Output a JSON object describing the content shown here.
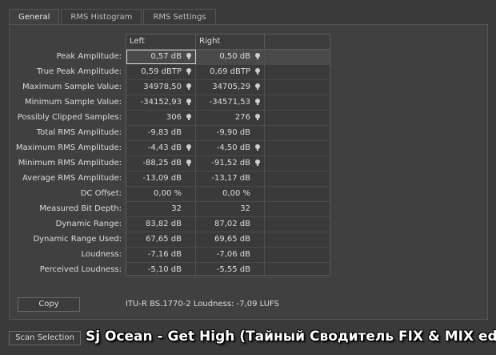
{
  "tabs": [
    "General",
    "RMS Histogram",
    "RMS Settings"
  ],
  "columns": {
    "left": "Left",
    "right": "Right"
  },
  "rows": [
    {
      "label": "Peak Amplitude:",
      "left": "0,57 dB",
      "right": "0,50 dB",
      "left_marker": true,
      "right_marker": true
    },
    {
      "label": "True Peak Amplitude:",
      "left": "0,59 dBTP",
      "right": "0,69 dBTP",
      "left_marker": true,
      "right_marker": true
    },
    {
      "label": "Maximum Sample Value:",
      "left": "34978,50",
      "right": "34705,29",
      "left_marker": true,
      "right_marker": true
    },
    {
      "label": "Minimum Sample Value:",
      "left": "-34152,93",
      "right": "-34571,53",
      "left_marker": true,
      "right_marker": true
    },
    {
      "label": "Possibly Clipped Samples:",
      "left": "306",
      "right": "276",
      "left_marker": true,
      "right_marker": true
    },
    {
      "label": "Total RMS Amplitude:",
      "left": "-9,83 dB",
      "right": "-9,90 dB",
      "left_marker": false,
      "right_marker": false
    },
    {
      "label": "Maximum RMS Amplitude:",
      "left": "-4,43 dB",
      "right": "-4,50 dB",
      "left_marker": true,
      "right_marker": true
    },
    {
      "label": "Minimum RMS Amplitude:",
      "left": "-88,25 dB",
      "right": "-91,52 dB",
      "left_marker": true,
      "right_marker": true
    },
    {
      "label": "Average RMS Amplitude:",
      "left": "-13,09 dB",
      "right": "-13,17 dB",
      "left_marker": false,
      "right_marker": false
    },
    {
      "label": "DC Offset:",
      "left": "0,00 %",
      "right": "0,00 %",
      "left_marker": false,
      "right_marker": false
    },
    {
      "label": "Measured Bit Depth:",
      "left": "32",
      "right": "32",
      "left_marker": false,
      "right_marker": false
    },
    {
      "label": "Dynamic Range:",
      "left": "83,82 dB",
      "right": "87,02 dB",
      "left_marker": false,
      "right_marker": false
    },
    {
      "label": "Dynamic Range Used:",
      "left": "67,65 dB",
      "right": "69,65 dB",
      "left_marker": false,
      "right_marker": false
    },
    {
      "label": "Loudness:",
      "left": "-7,16 dB",
      "right": "-7,06 dB",
      "left_marker": false,
      "right_marker": false
    },
    {
      "label": "Perceived Loudness:",
      "left": "-5,10 dB",
      "right": "-5,55 dB",
      "left_marker": false,
      "right_marker": false
    }
  ],
  "copy_label": "Copy",
  "loudness_text": "ITU-R BS.1770-2 Loudness: -7,09 LUFS",
  "scan_label": "Scan Selection",
  "overlay_title": "Sj Ocean - Get High (Тайный Сводитель FIX & MIX edit)"
}
